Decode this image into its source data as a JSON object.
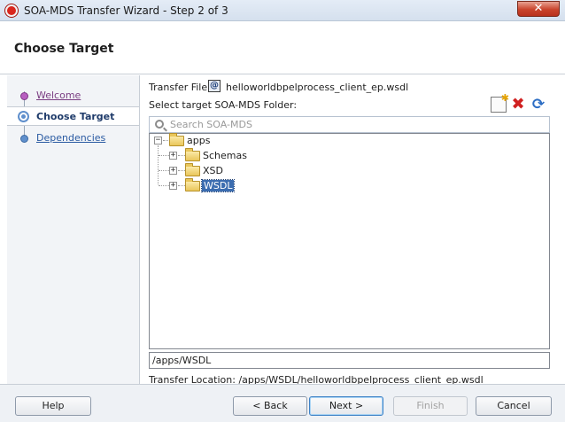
{
  "window": {
    "title": "SOA-MDS Transfer Wizard - Step 2 of 3",
    "close_label": "✕"
  },
  "header": {
    "title": "Choose Target"
  },
  "steps": [
    {
      "label": "Welcome"
    },
    {
      "label": "Choose Target"
    },
    {
      "label": "Dependencies"
    }
  ],
  "main": {
    "transfer_file_label": "Transfer File:",
    "file_icon_glyph": "@",
    "transfer_file": "helloworldbpelprocess_client_ep.wsdl",
    "select_label": "Select target SOA-MDS Folder:",
    "search_placeholder": "Search SOA-MDS",
    "tree": {
      "root": "apps",
      "children": [
        "Schemas",
        "XSD",
        "WSDL"
      ],
      "selected": "WSDL",
      "expanded_glyph": "−",
      "collapsed_glyph": "+"
    },
    "path_value": "/apps/WSDL",
    "transfer_location": "Transfer Location: /apps/WSDL/helloworldbpelprocess_client_ep.wsdl"
  },
  "buttons": {
    "help": "Help",
    "back": "< Back",
    "next": "Next >",
    "finish": "Finish",
    "cancel": "Cancel"
  },
  "icons": {
    "toolbar": [
      "new-folder-icon",
      "delete-icon",
      "refresh-icon"
    ],
    "delete_glyph": "✖",
    "refresh_glyph": "⟳"
  },
  "colors": {
    "accent": "#3c6db0",
    "close": "#c9442c",
    "visited": "#7a3d82"
  }
}
